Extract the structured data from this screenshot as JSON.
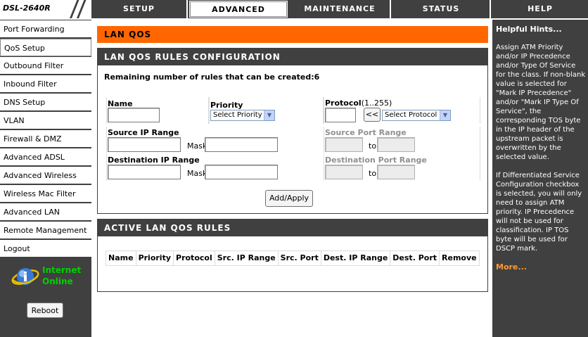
{
  "brand": {
    "model": "DSL-2640R"
  },
  "tabs": [
    {
      "label": "SETUP",
      "active": false
    },
    {
      "label": "ADVANCED",
      "active": true
    },
    {
      "label": "MAINTENANCE",
      "active": false
    },
    {
      "label": "STATUS",
      "active": false
    },
    {
      "label": "HELP",
      "active": false
    }
  ],
  "sidebar": {
    "items": [
      "Port Forwarding",
      "QoS Setup",
      "Outbound Filter",
      "Inbound Filter",
      "DNS Setup",
      "VLAN",
      "Firewall & DMZ",
      "Advanced ADSL",
      "Advanced Wireless",
      "Wireless Mac Filter",
      "Advanced LAN",
      "Remote Management",
      "Logout"
    ],
    "active_index": 1,
    "status_line1": "Internet",
    "status_line2": "Online",
    "reboot_label": "Reboot"
  },
  "main": {
    "section_title": "LAN QOS",
    "config": {
      "title": "LAN QOS RULES CONFIGURATION",
      "remaining_text": "Remaining number of rules that can be created:6",
      "name_label": "Name",
      "name_value": "",
      "priority_label": "Priority",
      "priority_selected": "Select Priority",
      "protocol_label": "Protocol",
      "protocol_hint": "(1..255)",
      "protocol_value": "",
      "copy_button": "<<",
      "protocol_selected": "Select Protocol",
      "src_ip_label": "Source IP Range",
      "src_ip_value": "",
      "mask_label": "Mask",
      "src_mask_value": "",
      "src_port_label": "Source Port Range",
      "to_label": "to",
      "dst_ip_label": "Destination IP Range",
      "dst_ip_value": "",
      "dst_mask_value": "",
      "dst_port_label": "Destination Port Range",
      "apply_button": "Add/Apply"
    },
    "active_rules": {
      "title": "ACTIVE LAN QOS RULES",
      "columns": [
        "Name",
        "Priority",
        "Protocol",
        "Src. IP Range",
        "Src. Port",
        "Dest. IP Range",
        "Dest. Port",
        "Remove"
      ],
      "rows": []
    }
  },
  "hints": {
    "title": "Helpful Hints...",
    "paragraph1": "Assign ATM Priority and/or IP Precedence and/or Type Of Service for the class. If non-blank value is selected for \"Mark IP Precedence\" and/or \"Mark IP Type Of Service\", the corresponding TOS byte in the IP header of the upstream packet is overwritten by the selected value.",
    "paragraph2": "If Differentiated Service Configuration checkbox is selected, you will only need to assign ATM priority. IP Precedence will not be used for classification. IP TOS byte will be used for DSCP mark.",
    "more_link": "More..."
  },
  "colors": {
    "frame": "#404040",
    "section_orange": "#ff6600",
    "status_green": "#00d000",
    "more_orange": "#ff9933"
  }
}
